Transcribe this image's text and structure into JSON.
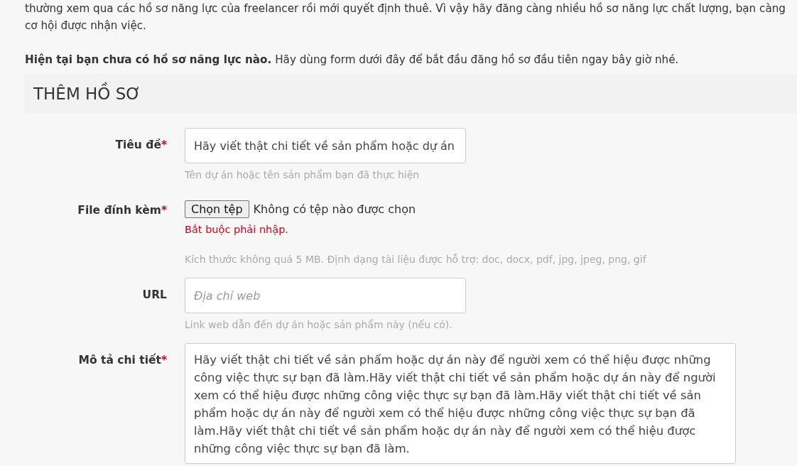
{
  "intro_lines": [
    "thường xem qua các hồ sơ năng lực của freelancer rồi mới quyết định thuê. Vì vậy hãy đăng càng nhiều hồ sơ năng lực chất lượng, bạn càng",
    "cơ hội được nhận việc."
  ],
  "notice": "**Hiện tại bạn chưa có hồ sơ năng lực nào.** Hãy dùng form dưới đây để bắt đầu đăng hồ sơ đầu tiên ngay bây giờ nhé.",
  "section_title": "THÊM HỒ SƠ",
  "required_mark": "*",
  "fields": [
    {
      "kind": "text",
      "label": "Tiêu đề",
      "required": true,
      "value": "Hãy viết thật chi tiết về sản phẩm hoặc dự án",
      "hint": "Tên dự án hoặc tên sản phẩm bạn đã thực hiện"
    },
    {
      "kind": "file",
      "label": "File đính kèm",
      "required": true,
      "button": "Chọn tệp",
      "status": "Không có tệp nào được chọn",
      "error": "Bắt buộc phải nhập.",
      "hint": "Kích thước không quá 5 MB. Định dạng tài liệu được hỗ trợ: doc, docx, pdf, jpg, jpeg, png, gif"
    },
    {
      "kind": "text",
      "label": "URL",
      "required": false,
      "placeholder": "Địa chỉ web",
      "hint": "Link web dẫn đến dự án hoặc sản phẩm này (nếu có)."
    },
    {
      "kind": "textarea",
      "label": "Mô tả chi tiết",
      "required": true,
      "value": "Hãy viết thật chi tiết về sản phẩm hoặc dự án này để người xem có thể hiệu được những công việc thực sự bạn đã làm.Hãy viết thật chi tiết về sản phẩm hoặc dự án này để người xem có thể hiệu được những công việc thực sự bạn đã làm.Hãy viết thật chi tiết về sản phẩm hoặc dự án này để người xem có thể hiệu được những công việc thực sự bạn đã làm.Hãy viết thật chi tiết về sản phẩm hoặc dự án này để người xem có thể hiệu được những công việc thực sự bạn đã làm."
    }
  ]
}
